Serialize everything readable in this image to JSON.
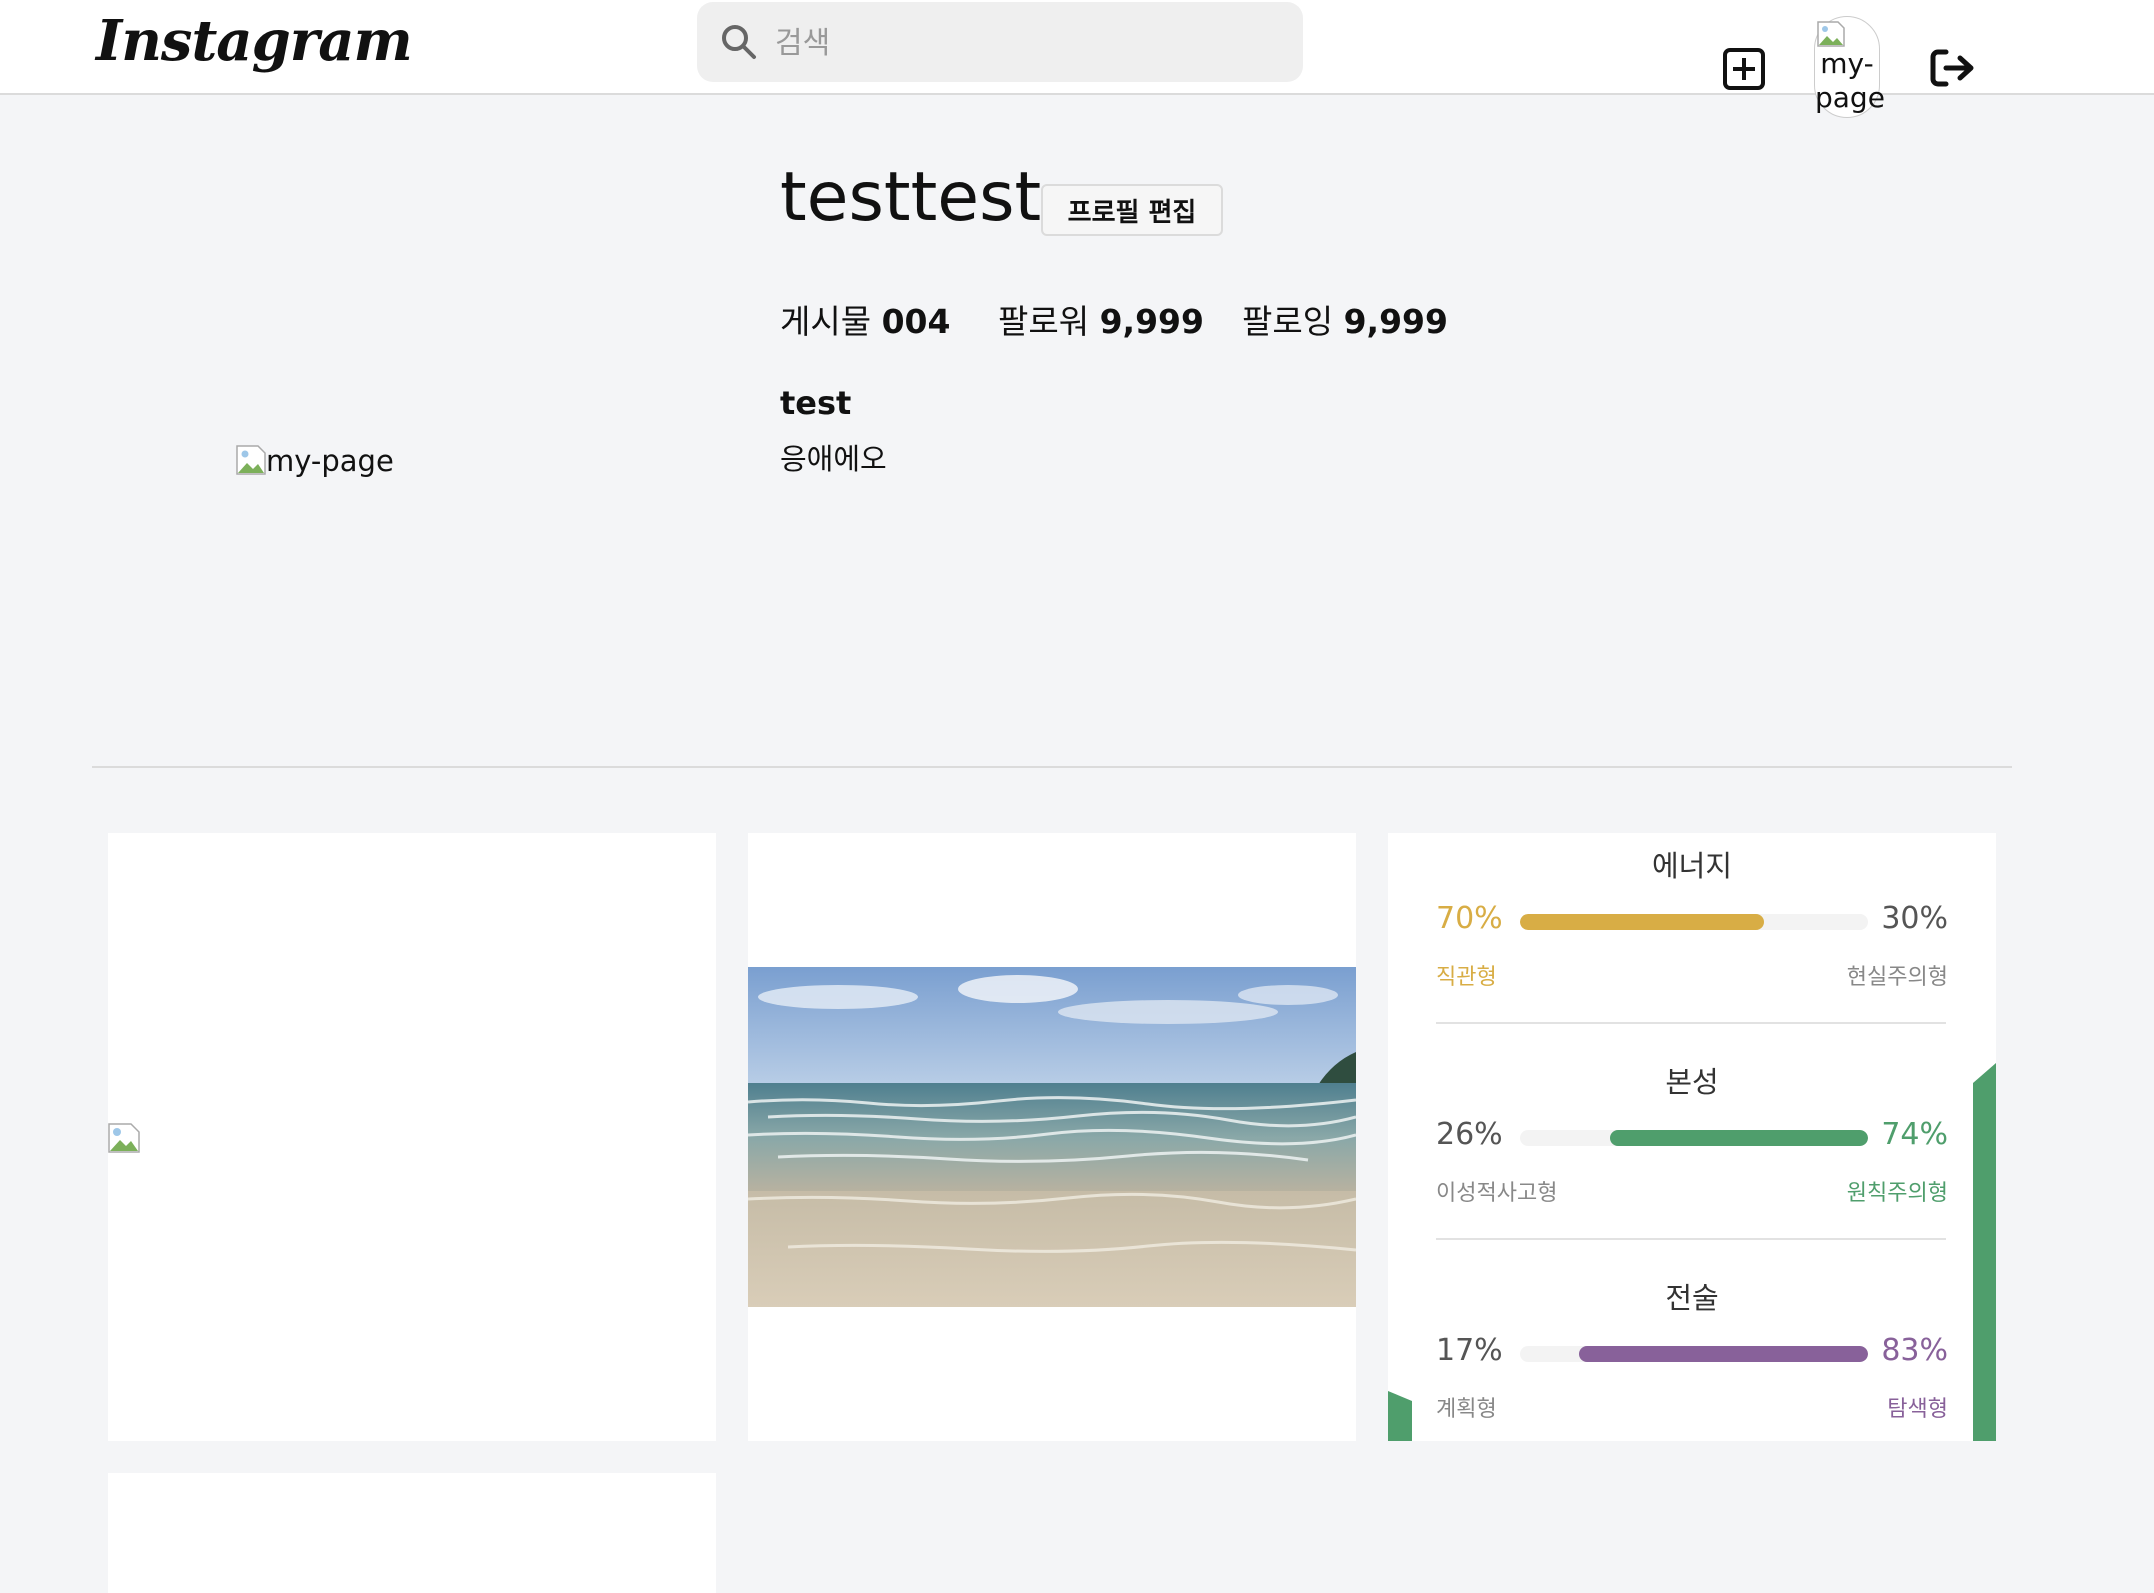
{
  "header": {
    "logo": "Instagram",
    "search_placeholder": "검색",
    "avatar_alt": "my-page"
  },
  "profile": {
    "username": "testtest",
    "edit_label": "프로필 편집",
    "stats": [
      {
        "label": "게시물",
        "value": "004"
      },
      {
        "label": "팔로워",
        "value": "9,999"
      },
      {
        "label": "팔로잉",
        "value": "9,999"
      }
    ],
    "display_name": "test",
    "bio": "응애에오",
    "image_alt": "my-page"
  },
  "mbti": {
    "sections": [
      {
        "title": "에너지",
        "left_pct": "70%",
        "right_pct": "30%",
        "left_label": "직관형",
        "right_label": "현실주의형",
        "dominant": "left",
        "fill_fraction": 0.7,
        "color": "#d8ad45"
      },
      {
        "title": "본성",
        "left_pct": "26%",
        "right_pct": "74%",
        "left_label": "이성적사고형",
        "right_label": "원칙주의형",
        "dominant": "right",
        "fill_fraction": 0.74,
        "color": "#4f9e6c"
      },
      {
        "title": "전술",
        "left_pct": "17%",
        "right_pct": "83%",
        "left_label": "계획형",
        "right_label": "탐색형",
        "dominant": "right",
        "fill_fraction": 0.83,
        "color": "#88619a"
      }
    ]
  },
  "colors": {
    "energy": "#d8ad45",
    "nature": "#4f9e6c",
    "tactics": "#88619a",
    "neutral_text": "#555555"
  }
}
